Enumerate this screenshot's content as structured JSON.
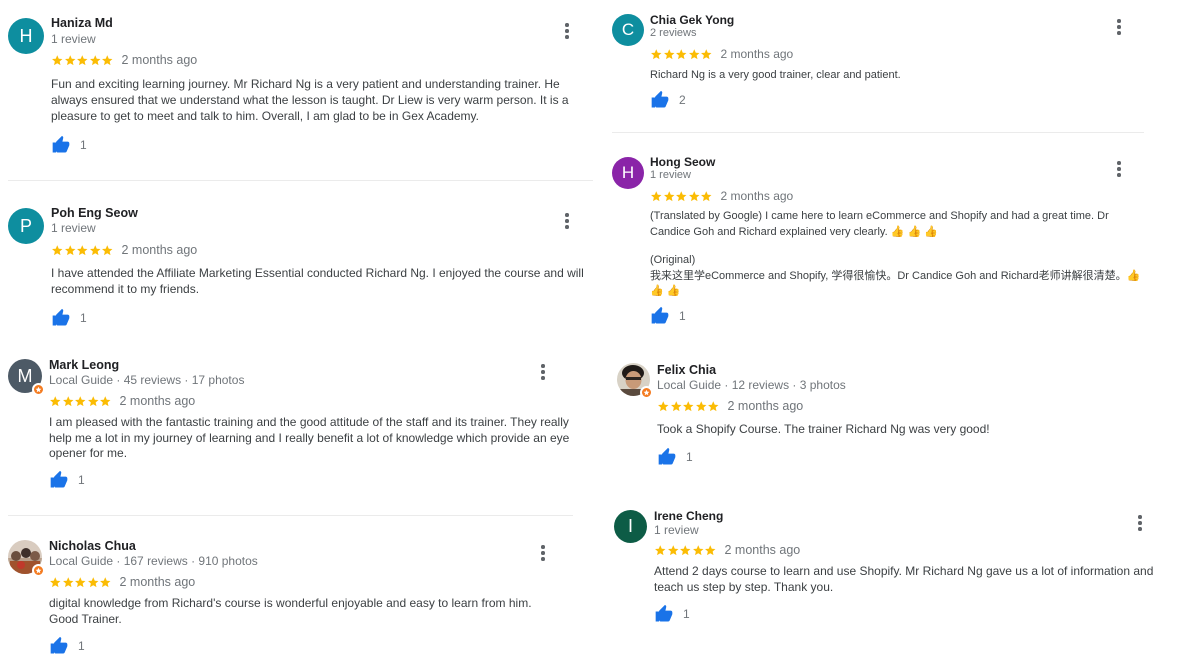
{
  "reviews": [
    {
      "id": "haniza",
      "name": "Haniza Md",
      "meta": "1 review",
      "initial": "H",
      "avatar_color": "#0e8e9f",
      "time": "2 months ago",
      "text": "Fun and exciting learning journey. Mr Richard Ng is a very patient and understanding trainer. He always ensured that we understand what the lesson is taught. Dr Liew is very warm person. It is a pleasure to get to meet and talk to him. Overall, I am glad to be in Gex Academy.",
      "likes": "1"
    },
    {
      "id": "poh",
      "name": "Poh Eng Seow",
      "meta": "1 review",
      "initial": "P",
      "avatar_color": "#0e8e9f",
      "time": "2 months ago",
      "text": "I have attended the Affiliate Marketing Essential conducted Richard Ng.  I enjoyed the course and will recommend it to my friends.",
      "likes": "1"
    },
    {
      "id": "mark",
      "name": "Mark Leong",
      "meta": "Local Guide · 45 reviews · 17 photos",
      "initial": "M",
      "avatar_color": "#4d5a66",
      "time": "2 months ago",
      "text": "I am pleased with the fantastic training and the good attitude of the staff and its trainer.  They really help me a lot in my journey of learning and I really benefit a lot of knowledge which provide an eye opener for me.",
      "likes": "1"
    },
    {
      "id": "nicholas",
      "name": "Nicholas Chua",
      "meta": "Local Guide · 167 reviews · 910 photos",
      "initial": "",
      "avatar_color": "#c9b7a6",
      "time": "2 months ago",
      "text": "digital knowledge from Richard's course is wonderful enjoyable and easy to learn from him. Good Trainer.",
      "likes": "1"
    },
    {
      "id": "chia",
      "name": "Chia Gek Yong",
      "meta": "2 reviews",
      "initial": "C",
      "avatar_color": "#0e8e9f",
      "time": "2 months ago",
      "text": "Richard Ng is a very good trainer, clear and patient.",
      "likes": "2"
    },
    {
      "id": "hong",
      "name": "Hong Seow",
      "meta": "1 review",
      "initial": "H",
      "avatar_color": "#8a24a8",
      "time": "2 months ago",
      "text": "(Translated by Google) I came here to learn eCommerce and Shopify and had a great time. Dr Candice Goh and Richard explained very clearly. 👍 👍 👍",
      "text2": "(Original)",
      "text3": "我来这里学eCommerce and Shopify, 学得很愉快。Dr Candice Goh and Richard老师讲解很清楚。👍 👍 👍",
      "likes": "1"
    },
    {
      "id": "felix",
      "name": "Felix Chia",
      "meta": "Local Guide · 12 reviews · 3 photos",
      "initial": "",
      "avatar_color": "#6b5a4c",
      "time": "2 months ago",
      "text": "Took a Shopify Course. The trainer Richard Ng was very good!",
      "likes": "1"
    },
    {
      "id": "irene",
      "name": "Irene Cheng",
      "meta": "1 review",
      "initial": "I",
      "avatar_color": "#0d5c46",
      "time": "2 months ago",
      "text": "Attend 2 days course to learn and use Shopify. Mr Richard Ng gave us a lot of information and teach us step by step. Thank you.",
      "likes": "1"
    }
  ],
  "colors": {
    "star": "#fbbc04",
    "like": "#1a73e8",
    "guide_badge": "#f47b20"
  },
  "icons": {
    "star": "star-icon",
    "like": "thumbs-up-icon",
    "menu": "more-vert-icon",
    "guide": "local-guide-badge-icon"
  }
}
